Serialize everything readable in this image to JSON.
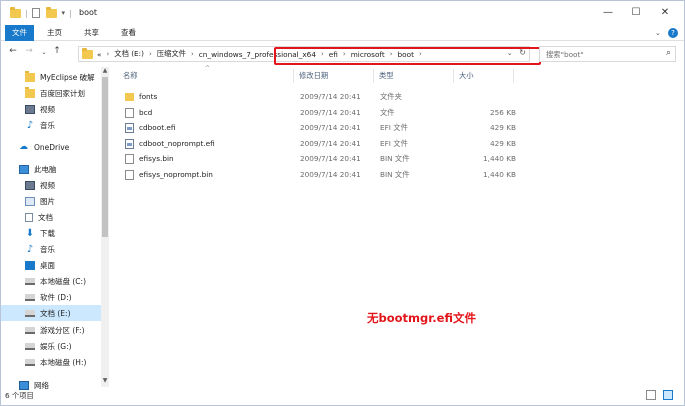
{
  "window": {
    "title": "boot",
    "minimize": "—",
    "maximize": "☐",
    "close": "✕"
  },
  "ribbon": {
    "tabs": [
      "文件",
      "主页",
      "共享",
      "查看"
    ],
    "expand_icon": "chevron-down-icon",
    "help_icon": "help-icon"
  },
  "address": {
    "breadcrumbs": [
      "«",
      "文档 (E:)",
      "压缩文件",
      "cn_windows_7_professional_x64",
      "efi",
      "microsoft",
      "boot"
    ],
    "highlight_color": "#e3151b"
  },
  "search": {
    "placeholder": "搜索\"boot\""
  },
  "sidebar": {
    "items": [
      {
        "label": "MyEclipse 破解",
        "icon": "folder-icon"
      },
      {
        "label": "百度回家计划",
        "icon": "folder-icon"
      },
      {
        "label": "视频",
        "icon": "video-icon"
      },
      {
        "label": "音乐",
        "icon": "music-icon"
      },
      {
        "label": "OneDrive",
        "icon": "cloud-icon"
      },
      {
        "label": "此电脑",
        "icon": "pc-icon"
      },
      {
        "label": "视频",
        "icon": "video-icon"
      },
      {
        "label": "图片",
        "icon": "picture-icon"
      },
      {
        "label": "文档",
        "icon": "document-icon"
      },
      {
        "label": "下载",
        "icon": "download-icon"
      },
      {
        "label": "音乐",
        "icon": "music-icon"
      },
      {
        "label": "桌面",
        "icon": "desktop-icon"
      },
      {
        "label": "本地磁盘 (C:)",
        "icon": "drive-icon"
      },
      {
        "label": "软件 (D:)",
        "icon": "drive-icon"
      },
      {
        "label": "文档 (E:)",
        "icon": "drive-icon",
        "selected": true
      },
      {
        "label": "游戏分区 (F:)",
        "icon": "drive-icon"
      },
      {
        "label": "娱乐 (G:)",
        "icon": "drive-icon"
      },
      {
        "label": "本地磁盘 (H:)",
        "icon": "drive-icon"
      },
      {
        "label": "网络",
        "icon": "network-icon"
      }
    ]
  },
  "columns": {
    "name": "名称",
    "date": "修改日期",
    "type": "类型",
    "size": "大小"
  },
  "files": [
    {
      "name": "fonts",
      "date": "2009/7/14 20:41",
      "type": "文件夹",
      "size": "",
      "icon": "folder"
    },
    {
      "name": "bcd",
      "date": "2009/7/14 20:41",
      "type": "文件",
      "size": "256 KB",
      "icon": "file"
    },
    {
      "name": "cdboot.efi",
      "date": "2009/7/14 20:41",
      "type": "EFI 文件",
      "size": "429 KB",
      "icon": "efi"
    },
    {
      "name": "cdboot_noprompt.efi",
      "date": "2009/7/14 20:41",
      "type": "EFI 文件",
      "size": "429 KB",
      "icon": "efi"
    },
    {
      "name": "efisys.bin",
      "date": "2009/7/14 20:41",
      "type": "BIN 文件",
      "size": "1,440 KB",
      "icon": "file"
    },
    {
      "name": "efisys_noprompt.bin",
      "date": "2009/7/14 20:41",
      "type": "BIN 文件",
      "size": "1,440 KB",
      "icon": "file"
    }
  ],
  "annotation": "无bootmgr.efi文件",
  "status": {
    "item_count": "6 个项目"
  }
}
